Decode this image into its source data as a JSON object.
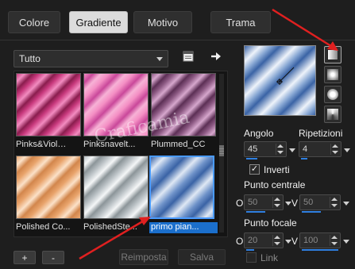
{
  "tabs": [
    {
      "label": "Colore",
      "active": false
    },
    {
      "label": "Gradiente",
      "active": true
    },
    {
      "label": "Motivo",
      "active": false
    },
    {
      "label": "Trama",
      "active": false
    }
  ],
  "category_select": {
    "value": "Tutto"
  },
  "gradients": [
    {
      "label": "Pinks&Violets",
      "display": "Pinks&Viol…",
      "selected": false
    },
    {
      "label": "Pinksnavelt...",
      "display": "Pinksnavelt...",
      "selected": false
    },
    {
      "label": "Plummed_CC",
      "display": "Plummed_CC",
      "selected": false
    },
    {
      "label": "Polished Co...",
      "display": "Polished Co...",
      "selected": false
    },
    {
      "label": "PolishedSte...",
      "display": "PolishedSte...",
      "selected": false
    },
    {
      "label": "primo pian...",
      "display": "primo pian...",
      "selected": true
    }
  ],
  "bottom_buttons": {
    "add": "+",
    "remove": "-",
    "reset": "Reimposta",
    "save": "Salva"
  },
  "angle": {
    "label": "Angolo",
    "value": "45"
  },
  "repeats": {
    "label": "Ripetizioni",
    "value": "4"
  },
  "invert": {
    "label": "Inverti",
    "checked": true
  },
  "center_point": {
    "label": "Punto centrale",
    "o_label": "O",
    "o_value": "50",
    "v_label": "V",
    "v_value": "50"
  },
  "focal_point": {
    "label": "Punto focale",
    "o_label": "O",
    "o_value": "20",
    "v_label": "V",
    "v_value": "100"
  },
  "link": {
    "label": "Link",
    "checked": false
  },
  "watermark": "Craficamia",
  "colors": {
    "accent": "#2f7fe0",
    "selection": "#1b6fcc",
    "arrow": "#e02020"
  }
}
